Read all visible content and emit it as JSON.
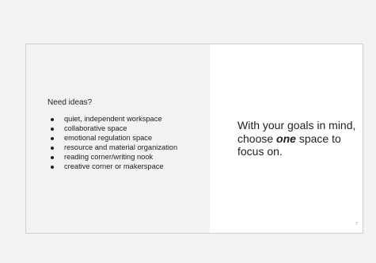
{
  "slide": {
    "ideas_heading": "Need ideas?",
    "ideas": [
      "quiet, independent workspace",
      "collaborative space",
      "emotional regulation space",
      "resource and material organization",
      "reading corner/writing nook",
      "creative corner or makerspace"
    ],
    "prompt_before": "With your goals in mind, choose ",
    "prompt_emphasis": "one",
    "prompt_after": " space to focus on.",
    "page_number": "7"
  }
}
